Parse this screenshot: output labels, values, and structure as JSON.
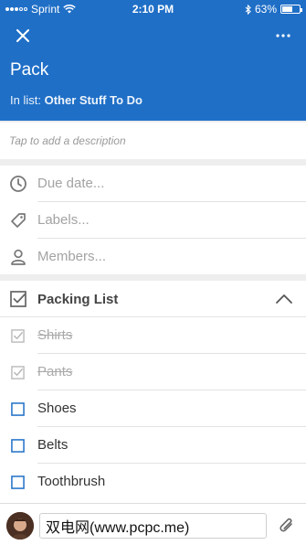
{
  "status_bar": {
    "carrier": "Sprint",
    "time": "2:10 PM",
    "battery": "63%",
    "battery_level": 0.63
  },
  "card": {
    "title": "Pack",
    "in_list_prefix": "In list:",
    "list_name": "Other Stuff To Do",
    "description_placeholder": "Tap to add a description"
  },
  "meta": {
    "due_date": "Due date...",
    "labels": "Labels...",
    "members": "Members..."
  },
  "checklist": {
    "title": "Packing List",
    "items": [
      {
        "label": "Shirts",
        "checked": true
      },
      {
        "label": "Pants",
        "checked": true
      },
      {
        "label": "Shoes",
        "checked": false
      },
      {
        "label": "Belts",
        "checked": false
      },
      {
        "label": "Toothbrush",
        "checked": false
      }
    ]
  },
  "comment": {
    "value": "双电网(www.pcpc.me)"
  },
  "colors": {
    "header": "#1f6fc7",
    "checkbox": "#1f6fc7",
    "checked": "#b5b5b5"
  },
  "icons": [
    "close-icon",
    "more-icon",
    "clock-icon",
    "tag-icon",
    "person-icon",
    "checklist-icon",
    "chevron-up-icon",
    "paperclip-icon"
  ]
}
